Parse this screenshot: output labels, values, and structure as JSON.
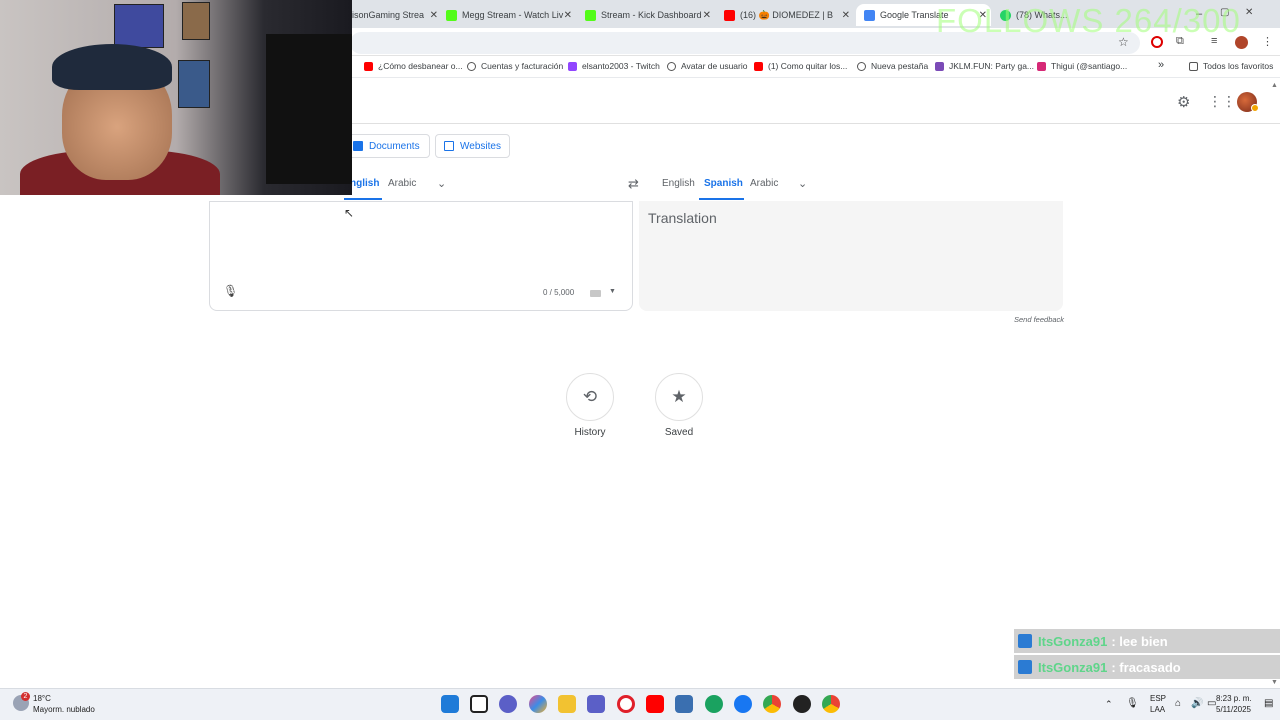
{
  "browser": {
    "tabs": [
      {
        "label": "isonGaming Strea",
        "color": "#5a3ea6"
      },
      {
        "label": "Megg Stream - Watch Liv",
        "color": "#53fc18"
      },
      {
        "label": "Stream - Kick Dashboard",
        "color": "#53fc18"
      },
      {
        "label": "(16) 🎃 DIOMEDEZ | B",
        "color": "#ff0000"
      },
      {
        "label": "Google Translate",
        "color": "#4285f4"
      },
      {
        "label": "(78) Whats...",
        "color": "#25d366"
      }
    ],
    "bookmarks": [
      {
        "label": "¿Cómo desbanear o...",
        "color": "#ff0000"
      },
      {
        "label": "Cuentas y facturación",
        "color": "#555555"
      },
      {
        "label": "elsanto2003 - Twitch",
        "color": "#9146ff"
      },
      {
        "label": "Avatar de usuario",
        "color": "#555555"
      },
      {
        "label": "(1) Como quitar los...",
        "color": "#ff0000"
      },
      {
        "label": "Nueva pestaña",
        "color": "#555555"
      },
      {
        "label": "JKLM.FUN: Party ga...",
        "color": "#7b4bb7"
      },
      {
        "label": "Thigui (@santiago...",
        "color": "#d62976"
      }
    ],
    "bookmarks_overflow": "»",
    "all_bookmarks": "Todos los favoritos"
  },
  "translate": {
    "mode_documents": "Documents",
    "mode_websites": "Websites",
    "source_langs": [
      "nglish",
      "Arabic"
    ],
    "target_langs": [
      "English",
      "Spanish",
      "Arabic"
    ],
    "source_counter": "0 / 5,000",
    "target_placeholder": "Translation",
    "send_feedback": "Send feedback",
    "history_label": "History",
    "saved_label": "Saved"
  },
  "overlay": {
    "follows": "FOLLOWS 264/300",
    "chat": [
      {
        "user": "ItsGonza91",
        "message": ": lee bien"
      },
      {
        "user": "ItsGonza91",
        "message": ": fracasado"
      }
    ]
  },
  "taskbar": {
    "weather_temp": "18°C",
    "weather_desc": "Mayorm. nublado",
    "weather_badge": "2",
    "lang_top": "ESP",
    "lang_bottom": "LAA",
    "time": "8:23 p. m.",
    "date": "5/11/2025"
  },
  "colors": {
    "accent": "#1a73e8",
    "chat_user": "#5fd58a",
    "follows": "#a0ff78"
  }
}
